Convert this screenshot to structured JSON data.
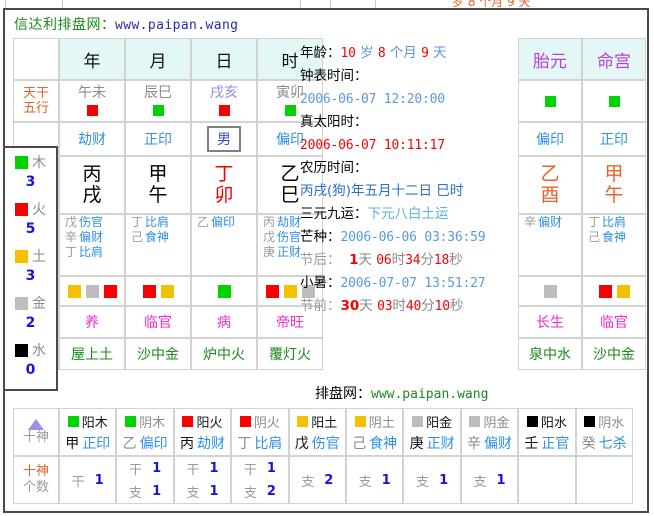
{
  "top_artifact": "岁 8 个月 9 天",
  "site": {
    "name": "信达利排盘网",
    "colon": "：",
    "url": "www.paipan.wang"
  },
  "footer": {
    "label": "排盘网：",
    "url": "www.paipan.wang"
  },
  "columns": {
    "headers": [
      "年",
      "月",
      "日",
      "时"
    ],
    "extra_headers": [
      "胎元",
      "命宫"
    ]
  },
  "row_labels": {
    "tiangan_wuxing": "天干\n五行",
    "tiangan": "天干",
    "wuxing": "五行",
    "shishen": "十神",
    "shishen_count": "十神\n个数"
  },
  "kongwang": {
    "values": [
      "午未",
      "辰巳",
      "戌亥",
      "寅卯"
    ],
    "colors": [
      "#8a8a8a",
      "#8a8a8a",
      "#8f8fe8",
      "#8a8a8a"
    ],
    "element_swatches": [
      "fire",
      "wood",
      "fire",
      "wood"
    ]
  },
  "ten_gods_row": {
    "year": "劫财",
    "month": "正印",
    "day": "男",
    "hour": "偏印",
    "taiyuan": "偏印",
    "minggong": "正印"
  },
  "pillars": [
    {
      "name": "year",
      "stem": "丙",
      "branch": "戌",
      "color": "#000000"
    },
    {
      "name": "month",
      "stem": "甲",
      "branch": "午",
      "color": "#000000"
    },
    {
      "name": "day",
      "stem": "丁",
      "branch": "卯",
      "color": "#fb0000"
    },
    {
      "name": "hour",
      "stem": "乙",
      "branch": "巳",
      "color": "#000000"
    }
  ],
  "extra_pillars": [
    {
      "name": "taiyuan",
      "stem": "乙",
      "branch": "酉",
      "color": "#e8622a"
    },
    {
      "name": "minggong",
      "stem": "甲",
      "branch": "午",
      "color": "#e8622a"
    }
  ],
  "hidden_stems": {
    "year": [
      {
        "stem": "戊",
        "god": "伤官"
      },
      {
        "stem": "辛",
        "god": "偏财"
      },
      {
        "stem": "丁",
        "god": "比肩"
      }
    ],
    "month": [
      {
        "stem": "丁",
        "god": "比肩"
      },
      {
        "stem": "己",
        "god": "食神"
      }
    ],
    "day": [
      {
        "stem": "乙",
        "god": "偏印"
      }
    ],
    "hour": [
      {
        "stem": "丙",
        "god": "劫财"
      },
      {
        "stem": "戊",
        "god": "伤官"
      },
      {
        "stem": "庚",
        "god": "正财"
      }
    ],
    "taiyuan": [
      {
        "stem": "辛",
        "god": "偏财"
      }
    ],
    "minggong": [
      {
        "stem": "丁",
        "god": "比肩"
      },
      {
        "stem": "己",
        "god": "食神"
      }
    ]
  },
  "branch_element_swatches": {
    "year": [
      "earth",
      "metal",
      "fire"
    ],
    "month": [
      "fire",
      "earth"
    ],
    "day": [
      "wood"
    ],
    "hour": [
      "fire",
      "earth",
      "metal"
    ],
    "taiyuan": [
      "metal"
    ],
    "minggong": [
      "fire",
      "earth"
    ]
  },
  "life_stages": {
    "year": "养",
    "month": "临官",
    "day": "病",
    "hour": "帝旺",
    "taiyuan": "长生",
    "minggong": "临官"
  },
  "nayin": {
    "year": "屋上土",
    "month": "沙中金",
    "day": "炉中火",
    "hour": "覆灯火",
    "taiyuan": "泉中水",
    "minggong": "沙中金"
  },
  "info": {
    "age": {
      "label": "年龄：",
      "years": "10",
      "years_unit": "岁",
      "months": "8",
      "months_unit": "个月",
      "days": "9",
      "days_unit": "天"
    },
    "clock_time": {
      "label": "钟表时间：",
      "value": "2006-06-07 12:20:00"
    },
    "true_solar": {
      "label": "真太阳时：",
      "value": "2006-06-07 10:11:17"
    },
    "lunar": {
      "label": "农历时间：",
      "value": "丙戌(狗)年五月十二日 巳时"
    },
    "sanyuan": {
      "label": "三元九运：",
      "value": "下元八白土运"
    },
    "jieqi_prev": {
      "label": "芒种：",
      "value": "2006-06-06 03:36:59"
    },
    "after_jie": {
      "label": "节后：",
      "days": "1",
      "days_unit": "天",
      "hours": "06",
      "hours_unit": "时",
      "minutes": "34",
      "minutes_unit": "分",
      "seconds": "18",
      "seconds_unit": "秒"
    },
    "jieqi_next": {
      "label": "小暑：",
      "value": "2006-07-07 13:51:27"
    },
    "before_jie": {
      "label": "节前：",
      "days": "30",
      "days_unit": "天",
      "hours": "03",
      "hours_unit": "时",
      "minutes": "40",
      "minutes_unit": "分",
      "seconds": "10",
      "seconds_unit": "秒"
    }
  },
  "five_elements": [
    {
      "name": "木",
      "count": "3",
      "swatch": "wood"
    },
    {
      "name": "火",
      "count": "5",
      "swatch": "fire"
    },
    {
      "name": "土",
      "count": "3",
      "swatch": "earth"
    },
    {
      "name": "金",
      "count": "2",
      "swatch": "metal"
    },
    {
      "name": "水",
      "count": "0",
      "swatch": "water"
    }
  ],
  "ten_gods_table": [
    {
      "swatch": "wood",
      "elem": "阳木",
      "elem_gray": false,
      "stem": "甲",
      "stem_gray": false,
      "god": "正印",
      "gan": "1",
      "zhi": ""
    },
    {
      "swatch": "wood",
      "elem": "阴木",
      "elem_gray": true,
      "stem": "乙",
      "stem_gray": true,
      "god": "偏印",
      "gan": "1",
      "zhi": "1"
    },
    {
      "swatch": "fire",
      "elem": "阳火",
      "elem_gray": false,
      "stem": "丙",
      "stem_gray": false,
      "god": "劫财",
      "gan": "1",
      "zhi": "1"
    },
    {
      "swatch": "fire",
      "elem": "阴火",
      "elem_gray": true,
      "stem": "丁",
      "stem_gray": true,
      "god": "比肩",
      "gan": "1",
      "zhi": "2"
    },
    {
      "swatch": "earth",
      "elem": "阳土",
      "elem_gray": false,
      "stem": "戊",
      "stem_gray": false,
      "god": "伤官",
      "gan": "",
      "zhi": "2"
    },
    {
      "swatch": "earth",
      "elem": "阴土",
      "elem_gray": true,
      "stem": "己",
      "stem_gray": true,
      "god": "食神",
      "gan": "",
      "zhi": "1"
    },
    {
      "swatch": "metal",
      "elem": "阳金",
      "elem_gray": false,
      "stem": "庚",
      "stem_gray": false,
      "god": "正财",
      "gan": "",
      "zhi": "1"
    },
    {
      "swatch": "metal",
      "elem": "阴金",
      "elem_gray": true,
      "stem": "辛",
      "stem_gray": true,
      "god": "偏财",
      "gan": "",
      "zhi": "1"
    },
    {
      "swatch": "water",
      "elem": "阳水",
      "elem_gray": false,
      "stem": "壬",
      "stem_gray": false,
      "god": "正官",
      "gan": "",
      "zhi": ""
    },
    {
      "swatch": "water",
      "elem": "阴水",
      "elem_gray": true,
      "stem": "癸",
      "stem_gray": true,
      "god": "七杀",
      "gan": "",
      "zhi": ""
    }
  ],
  "labels": {
    "gan": "干",
    "zhi": "支"
  }
}
